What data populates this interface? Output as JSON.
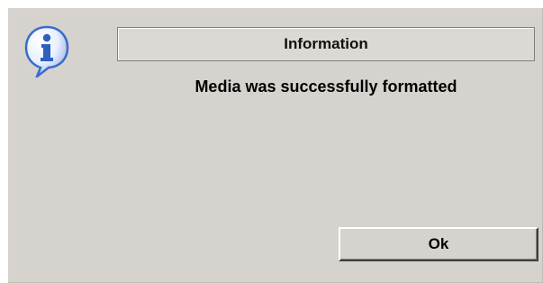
{
  "dialog": {
    "title": "Information",
    "message": "Media was successfully formatted",
    "icon": "info-icon",
    "ok_label": "Ok"
  },
  "colors": {
    "background": "#d6d3ce",
    "icon_blue": "#2f5fbf",
    "text": "#000000"
  }
}
